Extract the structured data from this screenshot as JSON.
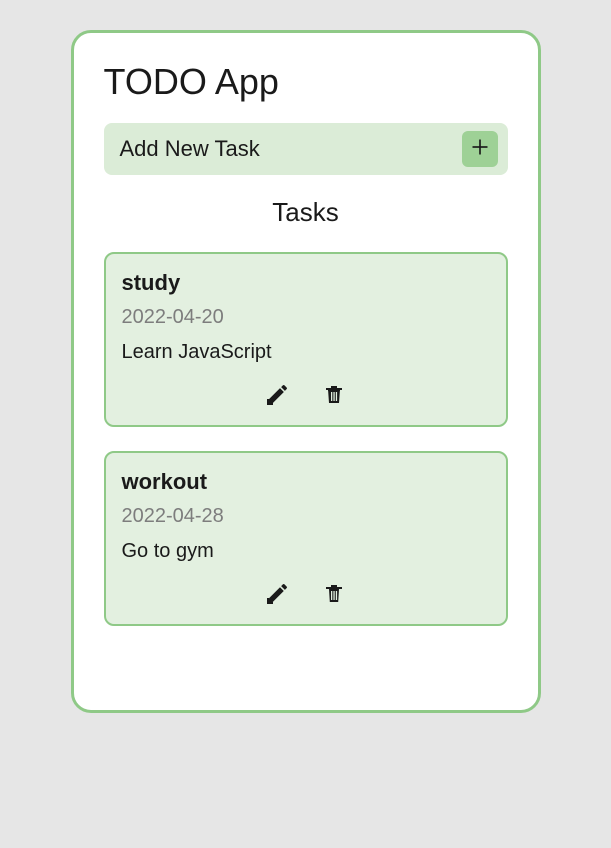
{
  "app": {
    "title": "TODO App",
    "addTask": {
      "label": "Add New Task"
    },
    "tasksHeading": "Tasks"
  },
  "tasks": [
    {
      "title": "study",
      "date": "2022-04-20",
      "desc": "Learn JavaScript"
    },
    {
      "title": "workout",
      "date": "2022-04-28",
      "desc": "Go to gym"
    }
  ]
}
